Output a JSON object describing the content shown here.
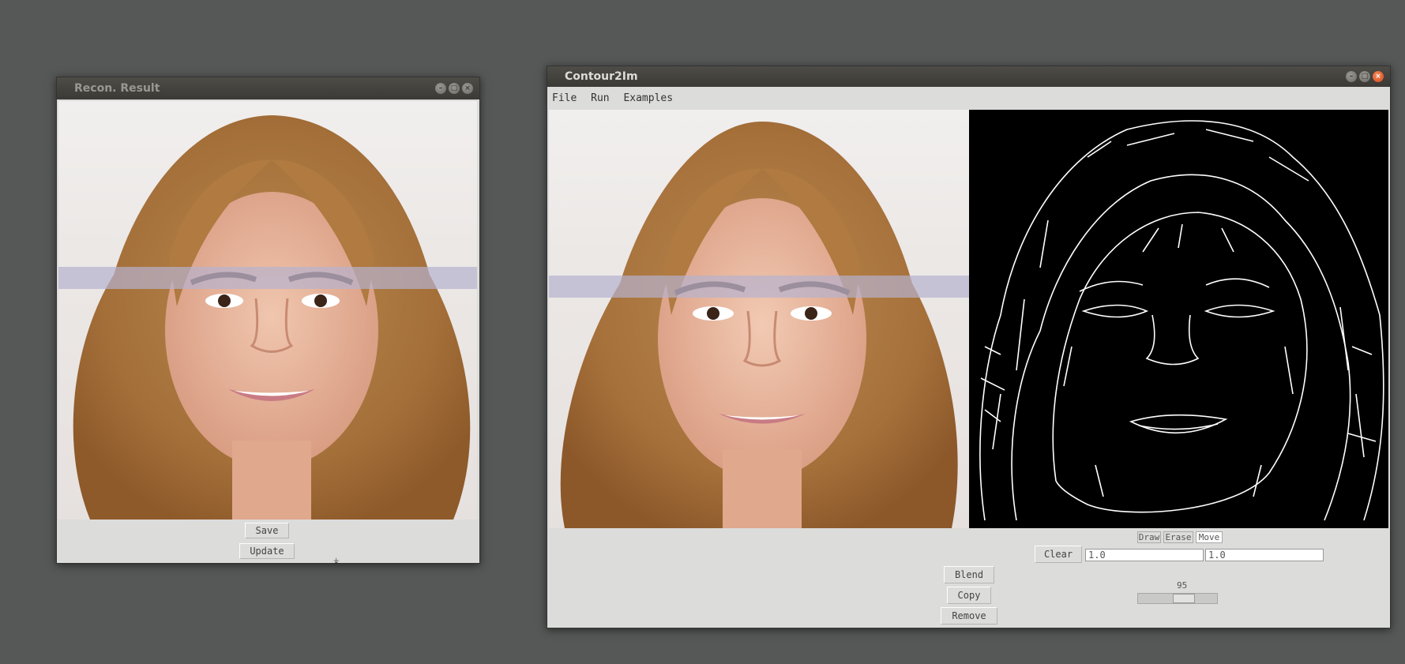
{
  "recon_window": {
    "title": "Recon. Result",
    "save_label": "Save",
    "update_label": "Update"
  },
  "main_window": {
    "title": "Contour2Im",
    "menu": [
      "File",
      "Run",
      "Examples"
    ],
    "modes": [
      "Draw",
      "Erase",
      "Move"
    ],
    "active_mode": "Move",
    "clear_label": "Clear",
    "field1_value": "1.0",
    "field2_value": "1.0",
    "blend_label": "Blend",
    "copy_label": "Copy",
    "remove_label": "Remove",
    "slider_value": "95"
  },
  "colors": {
    "desktop": "#565857",
    "window_bg": "#dcdcdb",
    "titlebar": "#3b3a36",
    "close_active": "#d8481c"
  },
  "icons": {
    "window_minimize": "minimize-icon",
    "window_maximize": "maximize-icon",
    "window_close": "close-icon",
    "mouse_cursor": "mouse-cursor-icon"
  }
}
